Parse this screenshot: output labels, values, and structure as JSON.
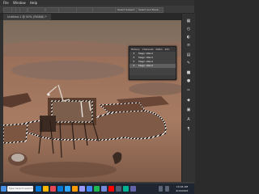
{
  "menu": {
    "items": [
      "File",
      "Window",
      "Help"
    ]
  },
  "document_tab": {
    "label": "Untitled-1 @ 50% (RGB/8) *"
  },
  "options": {
    "select_subject": "Select Subject",
    "select_mask": "Select and Mask..."
  },
  "history_panel": {
    "tabs": [
      "History",
      "Channels",
      "Paths",
      "Info"
    ],
    "items": [
      "Magic Wand",
      "Magic Wand",
      "Magic Wand",
      "Magic Wand"
    ]
  },
  "taskbar": {
    "search_placeholder": "Type here to search",
    "time": "10:44 AM",
    "date": "4/12/2021"
  }
}
